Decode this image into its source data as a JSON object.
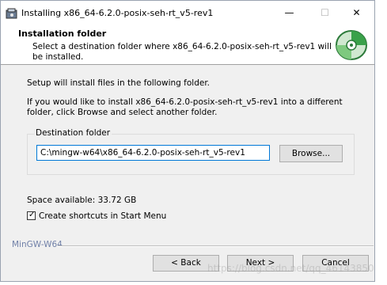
{
  "window": {
    "title": "Installing x86_64-6.2.0-posix-seh-rt_v5-rev1",
    "controls": {
      "minimize": "—",
      "maximize": "☐",
      "close": "✕"
    }
  },
  "header": {
    "title": "Installation folder",
    "subtitle": "Select a destination folder where x86_64-6.2.0-posix-seh-rt_v5-rev1 will be installed.",
    "icon": "cd-disc-icon"
  },
  "body": {
    "line1": "Setup will install files in the following folder.",
    "line2": "If you would like to install x86_64-6.2.0-posix-seh-rt_v5-rev1 into a different folder, click Browse and select another folder."
  },
  "destination": {
    "group_label": "Destination folder",
    "path": "C:\\mingw-w64\\x86_64-6.2.0-posix-seh-rt_v5-rev1",
    "browse_label": "Browse..."
  },
  "space_available": "Space available: 33.72 GB",
  "shortcut_checkbox": {
    "label": "Create shortcuts in Start Menu",
    "checked": true
  },
  "brand": "MinGW-W64",
  "buttons": {
    "back": "< Back",
    "next": "Next >",
    "cancel": "Cancel"
  },
  "watermark": "https://blog.csdn.net/qq_46143850",
  "colors": {
    "focus": "#0078d7",
    "brand_text": "#7080a8"
  }
}
